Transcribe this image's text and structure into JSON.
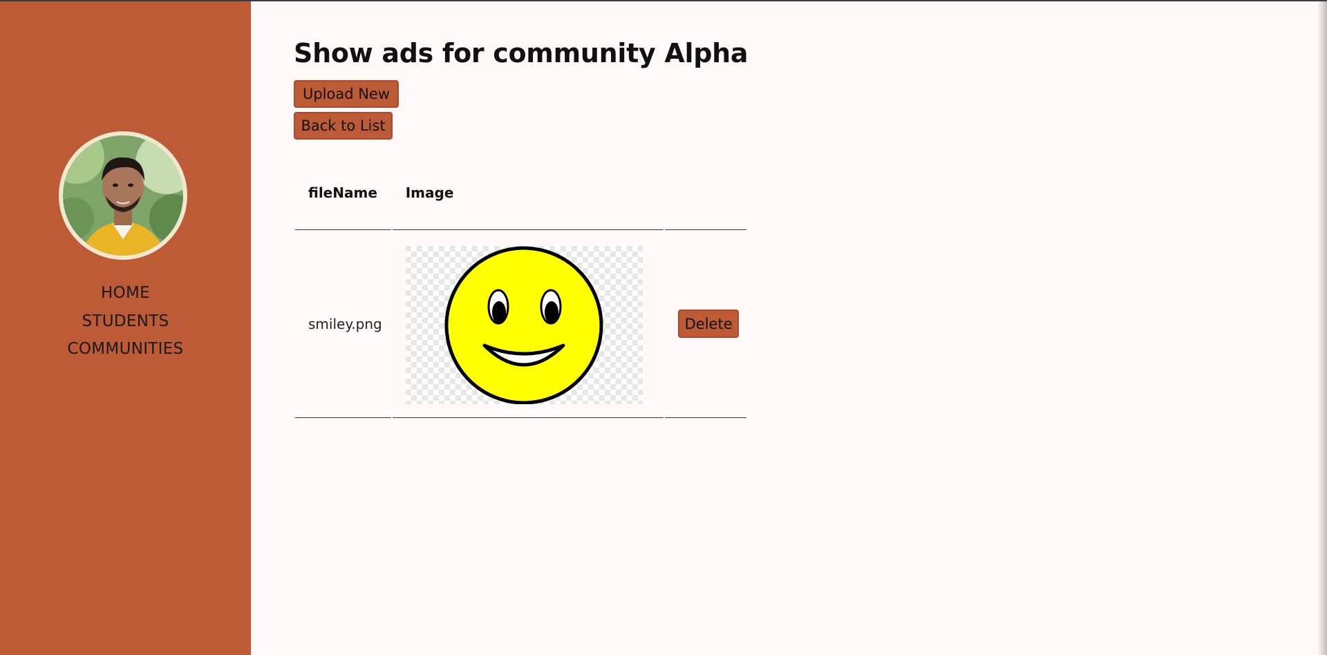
{
  "nav": {
    "items": [
      {
        "label": "HOME"
      },
      {
        "label": "STUDENTS"
      },
      {
        "label": "COMMUNITIES"
      }
    ]
  },
  "page": {
    "title": "Show ads for community Alpha",
    "upload_label": "Upload New",
    "back_label": "Back to List"
  },
  "table": {
    "headers": [
      "fileName",
      "Image",
      ""
    ],
    "rows": [
      {
        "fileName": "smiley.png",
        "image_icon": "smiley-face",
        "delete_label": "Delete"
      }
    ]
  },
  "colors": {
    "accent": "#bd5b36",
    "background": "#fff9f9",
    "smiley": "#ffff00"
  }
}
